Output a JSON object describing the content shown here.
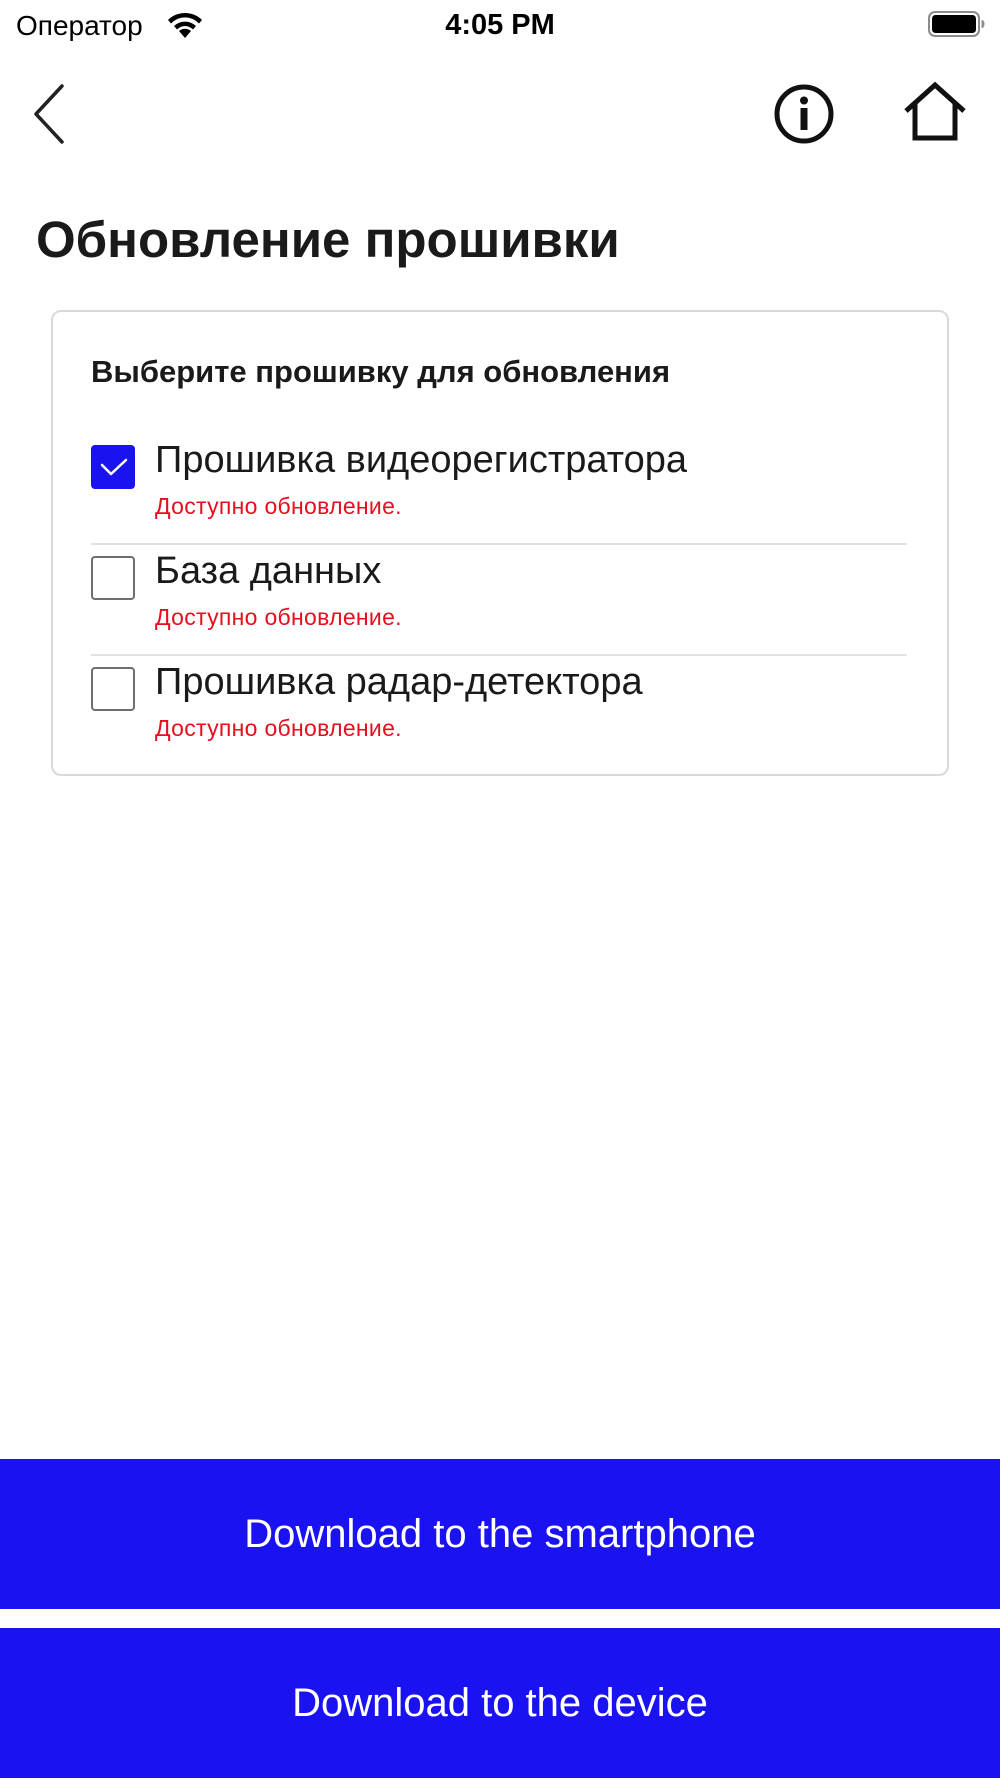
{
  "status_bar": {
    "carrier": "Оператор",
    "time": "4:05 PM",
    "wifi_icon": "wifi-icon",
    "battery_icon": "battery-full-icon"
  },
  "nav": {
    "back_icon": "chevron-left-icon",
    "info_icon": "info-circle-icon",
    "home_icon": "home-icon"
  },
  "page": {
    "title": "Обновление прошивки"
  },
  "card": {
    "heading": "Выберите прошивку для обновления",
    "options": [
      {
        "label": "Прошивка видеорегистратора",
        "status": "Доступно обновление.",
        "checked": true
      },
      {
        "label": "База данных",
        "status": "Доступно обновление.",
        "checked": false
      },
      {
        "label": "Прошивка радар-детектора",
        "status": "Доступно обновление.",
        "checked": false
      }
    ]
  },
  "actions": {
    "download_smartphone": "Download to the smartphone",
    "download_device": "Download to the device"
  },
  "colors": {
    "accent": "#1a12f0",
    "status_red": "#e4101e",
    "divider": "#e2e2e2"
  }
}
